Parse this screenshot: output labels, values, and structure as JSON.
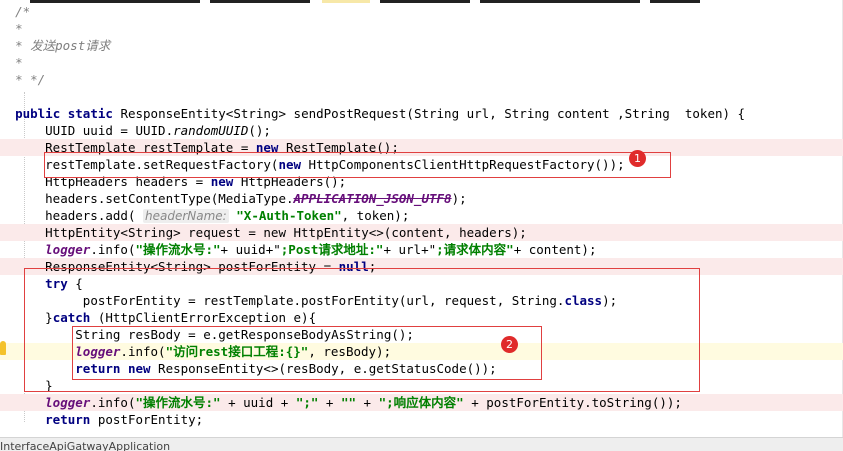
{
  "editor": {
    "comment": {
      "open": "/*",
      "star": "*",
      "desc_prefix": "* 发送",
      "desc_post": "post",
      "desc_suffix": "请求",
      "close": "* */"
    },
    "code": {
      "sig_kw": "public static",
      "sig_type": "ResponseEntity<String>",
      "sig_rest": " sendPostRequest(String url, String content ,String  token) {",
      "l1": "UUID uuid = UUID.",
      "l1_call": "randomUUID",
      "l1_end": "();",
      "l2_a": "RestTemplate restTemplate = ",
      "l2_kw": "new",
      "l2_b": " RestTemplate();",
      "l3_a": "restTemplate.setRequestFactory(",
      "l3_kw": "new",
      "l3_b": " HttpComponentsClientHttpRequestFactory());",
      "l4_a": "HttpHeaders headers = ",
      "l4_kw": "new",
      "l4_b": " HttpHeaders();",
      "l5_a": "headers.setContentType(MediaType.",
      "l5_const": "APPLICATION_JSON_UTF8",
      "l5_b": ");",
      "l6_a": "headers.add(",
      "l6_hint": "headerName:",
      "l6_str": "\"X-Auth-Token\"",
      "l6_b": ", token);",
      "l7": "HttpEntity<String> request = new HttpEntity<>(content, headers);",
      "l8_logger": "logger",
      "l8_a": ".info(",
      "l8_s1": "\"操作流水号:\"",
      "l8_b": "+ uuid+\"",
      "l8_s2": ";Post请求地址:\"",
      "l8_c": "+ url+\"",
      "l8_s3": ";请求体内容\"",
      "l8_d": "+ content);",
      "l9_a": "ResponseEntity<String> postForEntity = ",
      "l9_kw": "null",
      "l9_b": ";",
      "l10_kw": "try",
      "l10_b": " {",
      "l11_a": "postForEntity = restTemplate.postForEntity(url, request, String.",
      "l11_kw": "class",
      "l11_b": ");",
      "l12_a": "}",
      "l12_kw": "catch",
      "l12_b": " (HttpClientErrorException e){",
      "l13": "String resBody = e.getResponseBodyAsString();",
      "l14_logger": "logger",
      "l14_a": ".info(",
      "l14_str": "\"访问rest接口工程:{}\"",
      "l14_b": ", resBody);",
      "l15_kw1": "return",
      "l15_kw2": "new",
      "l15_b": " ResponseEntity<>(resBody, e.getStatusCode());",
      "l16": "}",
      "l17_logger": "logger",
      "l17_a": ".info(",
      "l17_s1": "\"操作流水号:\"",
      "l17_b": " + uuid + ",
      "l17_s2": "\";\"",
      "l17_c": " + ",
      "l17_s3": "\"\"",
      "l17_d": " + ",
      "l17_s4": "\";响应体内容\"",
      "l17_e": " + postForEntity.toString());",
      "l18_kw": "return",
      "l18_b": " postForEntity;"
    }
  },
  "annotations": {
    "badge1": "1",
    "badge2": "2"
  },
  "status_bar": {
    "text": "InterfaceApiGatwayApplication"
  },
  "colors": {
    "keyword": "#000080",
    "string": "#008000",
    "comment": "#808080",
    "annotation_box": "#e04040",
    "badge": "#e02b2b",
    "line_highlight": "#fbeaea"
  }
}
